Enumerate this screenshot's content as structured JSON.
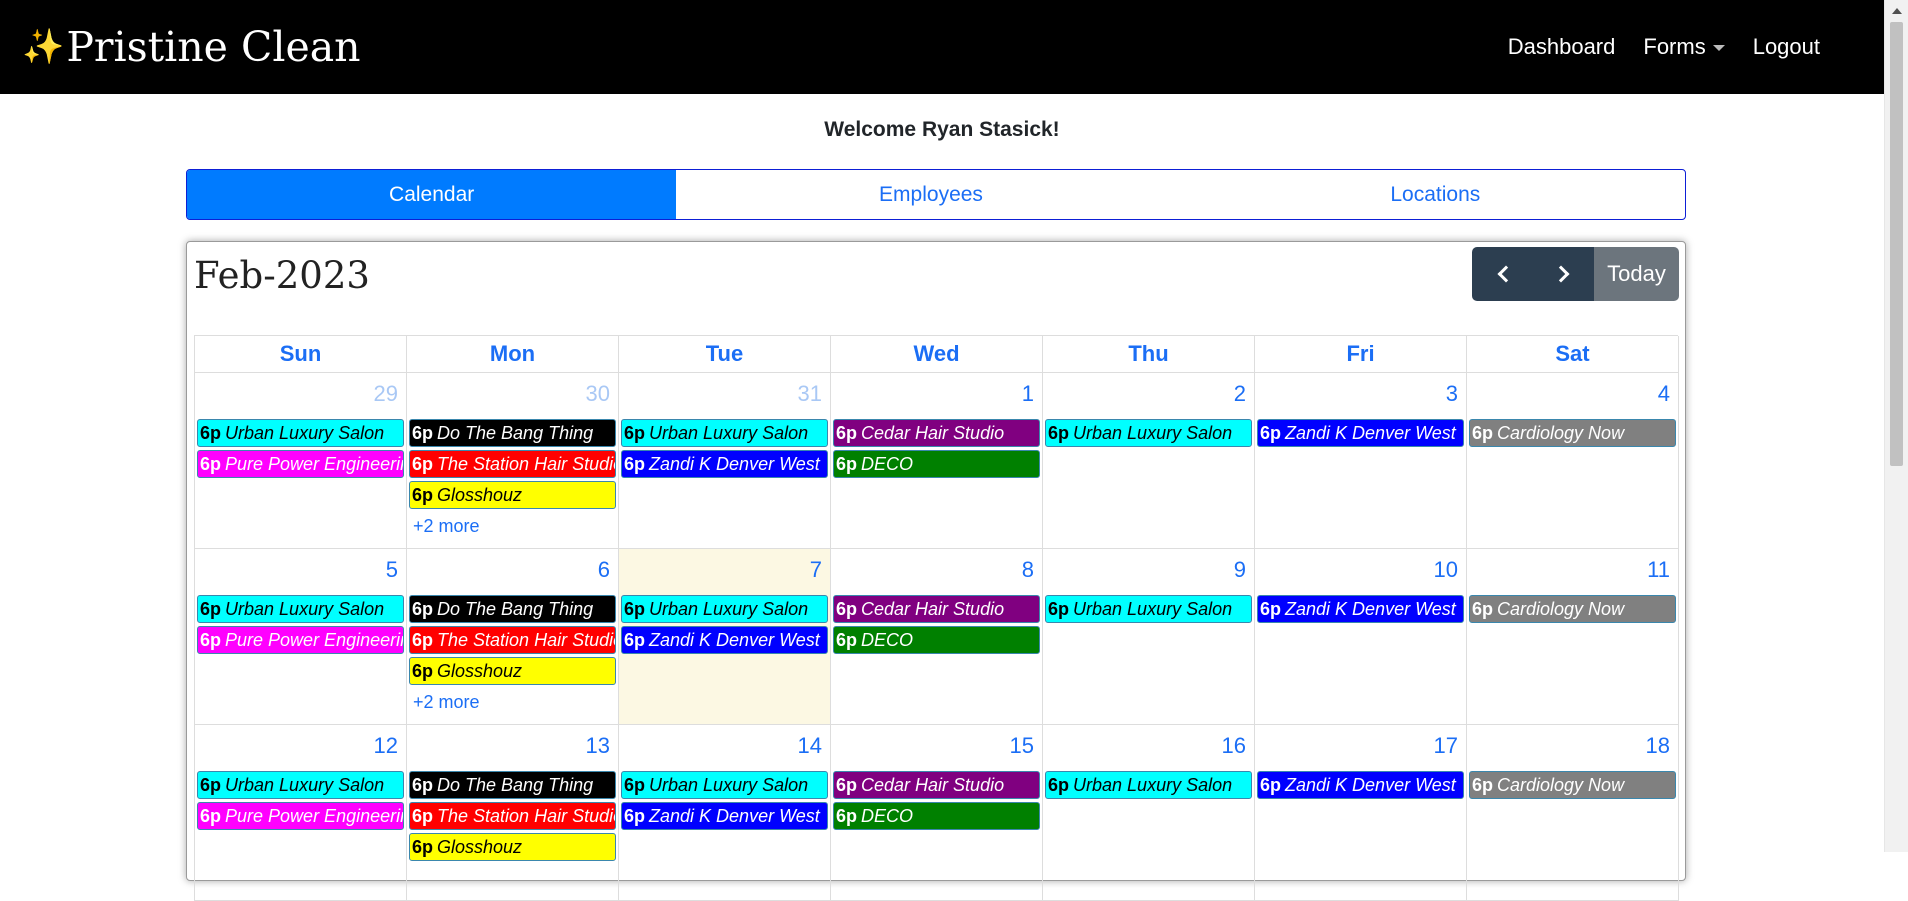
{
  "brand": {
    "icon": "✨",
    "name": "Pristine Clean"
  },
  "nav": {
    "dashboard": "Dashboard",
    "forms": "Forms",
    "logout": "Logout"
  },
  "welcome": "Welcome Ryan Stasick!",
  "tabs": [
    "Calendar",
    "Employees",
    "Locations"
  ],
  "calendar": {
    "month": "Feb-2023",
    "today_label": "Today",
    "days_of_week": [
      "Sun",
      "Mon",
      "Tue",
      "Wed",
      "Thu",
      "Fri",
      "Sat"
    ],
    "weeks": [
      {
        "days": [
          {
            "num": "29",
            "other": true,
            "events": [
              {
                "time": "6p",
                "title": "Urban Luxury Salon",
                "bg": "#00ffff",
                "fg": "#000000"
              },
              {
                "time": "6p",
                "title": "Pure Power Engineering",
                "bg": "#ff00ff",
                "fg": "#ffffff"
              }
            ]
          },
          {
            "num": "30",
            "other": true,
            "events": [
              {
                "time": "6p",
                "title": "Do The Bang Thing",
                "bg": "#000000",
                "fg": "#ffffff"
              },
              {
                "time": "6p",
                "title": "The Station Hair Studio",
                "bg": "#ff0000",
                "fg": "#ffffff"
              },
              {
                "time": "6p",
                "title": "Glosshouz",
                "bg": "#ffff00",
                "fg": "#000000"
              }
            ],
            "more": "+2 more"
          },
          {
            "num": "31",
            "other": true,
            "events": [
              {
                "time": "6p",
                "title": "Urban Luxury Salon",
                "bg": "#00ffff",
                "fg": "#000000"
              },
              {
                "time": "6p",
                "title": "Zandi K Denver West",
                "bg": "#0000ff",
                "fg": "#ffffff"
              }
            ]
          },
          {
            "num": "1",
            "events": [
              {
                "time": "6p",
                "title": "Cedar Hair Studio",
                "bg": "#800080",
                "fg": "#ffffff"
              },
              {
                "time": "6p",
                "title": "DECO",
                "bg": "#008000",
                "fg": "#ffffff"
              }
            ]
          },
          {
            "num": "2",
            "events": [
              {
                "time": "6p",
                "title": "Urban Luxury Salon",
                "bg": "#00ffff",
                "fg": "#000000"
              }
            ]
          },
          {
            "num": "3",
            "events": [
              {
                "time": "6p",
                "title": "Zandi K Denver West",
                "bg": "#0000ff",
                "fg": "#ffffff"
              }
            ]
          },
          {
            "num": "4",
            "events": [
              {
                "time": "6p",
                "title": "Cardiology Now",
                "bg": "#808080",
                "fg": "#ffffff"
              }
            ]
          }
        ]
      },
      {
        "days": [
          {
            "num": "5",
            "events": [
              {
                "time": "6p",
                "title": "Urban Luxury Salon",
                "bg": "#00ffff",
                "fg": "#000000"
              },
              {
                "time": "6p",
                "title": "Pure Power Engineering",
                "bg": "#ff00ff",
                "fg": "#ffffff"
              }
            ]
          },
          {
            "num": "6",
            "events": [
              {
                "time": "6p",
                "title": "Do The Bang Thing",
                "bg": "#000000",
                "fg": "#ffffff"
              },
              {
                "time": "6p",
                "title": "The Station Hair Studio",
                "bg": "#ff0000",
                "fg": "#ffffff"
              },
              {
                "time": "6p",
                "title": "Glosshouz",
                "bg": "#ffff00",
                "fg": "#000000"
              }
            ],
            "more": "+2 more"
          },
          {
            "num": "7",
            "today": true,
            "events": [
              {
                "time": "6p",
                "title": "Urban Luxury Salon",
                "bg": "#00ffff",
                "fg": "#000000"
              },
              {
                "time": "6p",
                "title": "Zandi K Denver West",
                "bg": "#0000ff",
                "fg": "#ffffff"
              }
            ]
          },
          {
            "num": "8",
            "events": [
              {
                "time": "6p",
                "title": "Cedar Hair Studio",
                "bg": "#800080",
                "fg": "#ffffff"
              },
              {
                "time": "6p",
                "title": "DECO",
                "bg": "#008000",
                "fg": "#ffffff"
              }
            ]
          },
          {
            "num": "9",
            "events": [
              {
                "time": "6p",
                "title": "Urban Luxury Salon",
                "bg": "#00ffff",
                "fg": "#000000"
              }
            ]
          },
          {
            "num": "10",
            "events": [
              {
                "time": "6p",
                "title": "Zandi K Denver West",
                "bg": "#0000ff",
                "fg": "#ffffff"
              }
            ]
          },
          {
            "num": "11",
            "events": [
              {
                "time": "6p",
                "title": "Cardiology Now",
                "bg": "#808080",
                "fg": "#ffffff"
              }
            ]
          }
        ]
      },
      {
        "days": [
          {
            "num": "12",
            "events": [
              {
                "time": "6p",
                "title": "Urban Luxury Salon",
                "bg": "#00ffff",
                "fg": "#000000"
              },
              {
                "time": "6p",
                "title": "Pure Power Engineering",
                "bg": "#ff00ff",
                "fg": "#ffffff"
              }
            ]
          },
          {
            "num": "13",
            "events": [
              {
                "time": "6p",
                "title": "Do The Bang Thing",
                "bg": "#000000",
                "fg": "#ffffff"
              },
              {
                "time": "6p",
                "title": "The Station Hair Studio",
                "bg": "#ff0000",
                "fg": "#ffffff"
              },
              {
                "time": "6p",
                "title": "Glosshouz",
                "bg": "#ffff00",
                "fg": "#000000"
              }
            ]
          },
          {
            "num": "14",
            "events": [
              {
                "time": "6p",
                "title": "Urban Luxury Salon",
                "bg": "#00ffff",
                "fg": "#000000"
              },
              {
                "time": "6p",
                "title": "Zandi K Denver West",
                "bg": "#0000ff",
                "fg": "#ffffff"
              }
            ]
          },
          {
            "num": "15",
            "events": [
              {
                "time": "6p",
                "title": "Cedar Hair Studio",
                "bg": "#800080",
                "fg": "#ffffff"
              },
              {
                "time": "6p",
                "title": "DECO",
                "bg": "#008000",
                "fg": "#ffffff"
              }
            ]
          },
          {
            "num": "16",
            "events": [
              {
                "time": "6p",
                "title": "Urban Luxury Salon",
                "bg": "#00ffff",
                "fg": "#000000"
              }
            ]
          },
          {
            "num": "17",
            "events": [
              {
                "time": "6p",
                "title": "Zandi K Denver West",
                "bg": "#0000ff",
                "fg": "#ffffff"
              }
            ]
          },
          {
            "num": "18",
            "events": [
              {
                "time": "6p",
                "title": "Cardiology Now",
                "bg": "#808080",
                "fg": "#ffffff"
              }
            ]
          }
        ]
      }
    ]
  }
}
